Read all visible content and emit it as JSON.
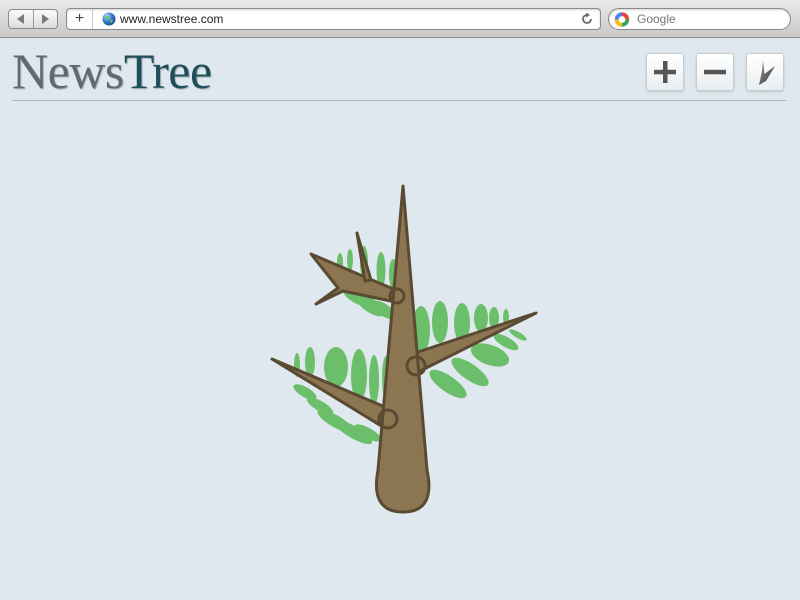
{
  "browser": {
    "url": "www.newstree.com",
    "search_placeholder": "Google",
    "new_tab_symbol": "+"
  },
  "header": {
    "logo_part1": "News",
    "logo_part2": "Tree"
  },
  "toolbar": {
    "buttons": [
      {
        "icon": "plus-icon"
      },
      {
        "icon": "minus-icon"
      },
      {
        "icon": "thorn-icon"
      }
    ]
  },
  "colors": {
    "background": "#dfe8ee",
    "trunk": "#8b7651",
    "trunk_outline": "#5a4a32",
    "leaf": "#6cbf6a",
    "logo_news": "#5d6a6e",
    "logo_tree": "#1f4f5a"
  }
}
